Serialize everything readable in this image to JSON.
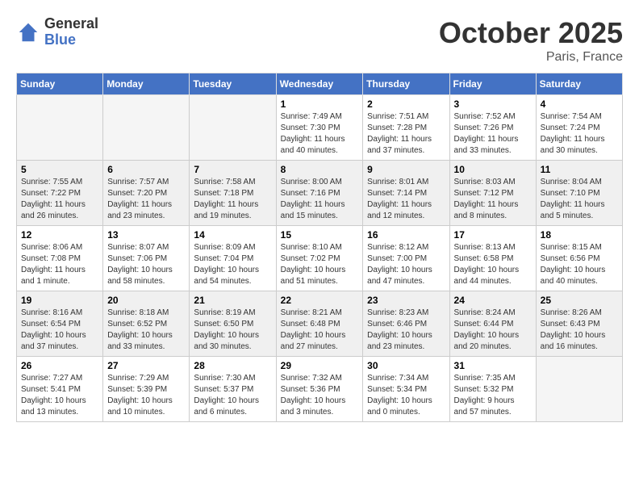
{
  "header": {
    "logo_line1": "General",
    "logo_line2": "Blue",
    "month": "October 2025",
    "location": "Paris, France"
  },
  "days_of_week": [
    "Sunday",
    "Monday",
    "Tuesday",
    "Wednesday",
    "Thursday",
    "Friday",
    "Saturday"
  ],
  "weeks": [
    [
      {
        "day": "",
        "content": ""
      },
      {
        "day": "",
        "content": ""
      },
      {
        "day": "",
        "content": ""
      },
      {
        "day": "1",
        "content": "Sunrise: 7:49 AM\nSunset: 7:30 PM\nDaylight: 11 hours\nand 40 minutes."
      },
      {
        "day": "2",
        "content": "Sunrise: 7:51 AM\nSunset: 7:28 PM\nDaylight: 11 hours\nand 37 minutes."
      },
      {
        "day": "3",
        "content": "Sunrise: 7:52 AM\nSunset: 7:26 PM\nDaylight: 11 hours\nand 33 minutes."
      },
      {
        "day": "4",
        "content": "Sunrise: 7:54 AM\nSunset: 7:24 PM\nDaylight: 11 hours\nand 30 minutes."
      }
    ],
    [
      {
        "day": "5",
        "content": "Sunrise: 7:55 AM\nSunset: 7:22 PM\nDaylight: 11 hours\nand 26 minutes."
      },
      {
        "day": "6",
        "content": "Sunrise: 7:57 AM\nSunset: 7:20 PM\nDaylight: 11 hours\nand 23 minutes."
      },
      {
        "day": "7",
        "content": "Sunrise: 7:58 AM\nSunset: 7:18 PM\nDaylight: 11 hours\nand 19 minutes."
      },
      {
        "day": "8",
        "content": "Sunrise: 8:00 AM\nSunset: 7:16 PM\nDaylight: 11 hours\nand 15 minutes."
      },
      {
        "day": "9",
        "content": "Sunrise: 8:01 AM\nSunset: 7:14 PM\nDaylight: 11 hours\nand 12 minutes."
      },
      {
        "day": "10",
        "content": "Sunrise: 8:03 AM\nSunset: 7:12 PM\nDaylight: 11 hours\nand 8 minutes."
      },
      {
        "day": "11",
        "content": "Sunrise: 8:04 AM\nSunset: 7:10 PM\nDaylight: 11 hours\nand 5 minutes."
      }
    ],
    [
      {
        "day": "12",
        "content": "Sunrise: 8:06 AM\nSunset: 7:08 PM\nDaylight: 11 hours\nand 1 minute."
      },
      {
        "day": "13",
        "content": "Sunrise: 8:07 AM\nSunset: 7:06 PM\nDaylight: 10 hours\nand 58 minutes."
      },
      {
        "day": "14",
        "content": "Sunrise: 8:09 AM\nSunset: 7:04 PM\nDaylight: 10 hours\nand 54 minutes."
      },
      {
        "day": "15",
        "content": "Sunrise: 8:10 AM\nSunset: 7:02 PM\nDaylight: 10 hours\nand 51 minutes."
      },
      {
        "day": "16",
        "content": "Sunrise: 8:12 AM\nSunset: 7:00 PM\nDaylight: 10 hours\nand 47 minutes."
      },
      {
        "day": "17",
        "content": "Sunrise: 8:13 AM\nSunset: 6:58 PM\nDaylight: 10 hours\nand 44 minutes."
      },
      {
        "day": "18",
        "content": "Sunrise: 8:15 AM\nSunset: 6:56 PM\nDaylight: 10 hours\nand 40 minutes."
      }
    ],
    [
      {
        "day": "19",
        "content": "Sunrise: 8:16 AM\nSunset: 6:54 PM\nDaylight: 10 hours\nand 37 minutes."
      },
      {
        "day": "20",
        "content": "Sunrise: 8:18 AM\nSunset: 6:52 PM\nDaylight: 10 hours\nand 33 minutes."
      },
      {
        "day": "21",
        "content": "Sunrise: 8:19 AM\nSunset: 6:50 PM\nDaylight: 10 hours\nand 30 minutes."
      },
      {
        "day": "22",
        "content": "Sunrise: 8:21 AM\nSunset: 6:48 PM\nDaylight: 10 hours\nand 27 minutes."
      },
      {
        "day": "23",
        "content": "Sunrise: 8:23 AM\nSunset: 6:46 PM\nDaylight: 10 hours\nand 23 minutes."
      },
      {
        "day": "24",
        "content": "Sunrise: 8:24 AM\nSunset: 6:44 PM\nDaylight: 10 hours\nand 20 minutes."
      },
      {
        "day": "25",
        "content": "Sunrise: 8:26 AM\nSunset: 6:43 PM\nDaylight: 10 hours\nand 16 minutes."
      }
    ],
    [
      {
        "day": "26",
        "content": "Sunrise: 7:27 AM\nSunset: 5:41 PM\nDaylight: 10 hours\nand 13 minutes."
      },
      {
        "day": "27",
        "content": "Sunrise: 7:29 AM\nSunset: 5:39 PM\nDaylight: 10 hours\nand 10 minutes."
      },
      {
        "day": "28",
        "content": "Sunrise: 7:30 AM\nSunset: 5:37 PM\nDaylight: 10 hours\nand 6 minutes."
      },
      {
        "day": "29",
        "content": "Sunrise: 7:32 AM\nSunset: 5:36 PM\nDaylight: 10 hours\nand 3 minutes."
      },
      {
        "day": "30",
        "content": "Sunrise: 7:34 AM\nSunset: 5:34 PM\nDaylight: 10 hours\nand 0 minutes."
      },
      {
        "day": "31",
        "content": "Sunrise: 7:35 AM\nSunset: 5:32 PM\nDaylight: 9 hours\nand 57 minutes."
      },
      {
        "day": "",
        "content": ""
      }
    ]
  ]
}
